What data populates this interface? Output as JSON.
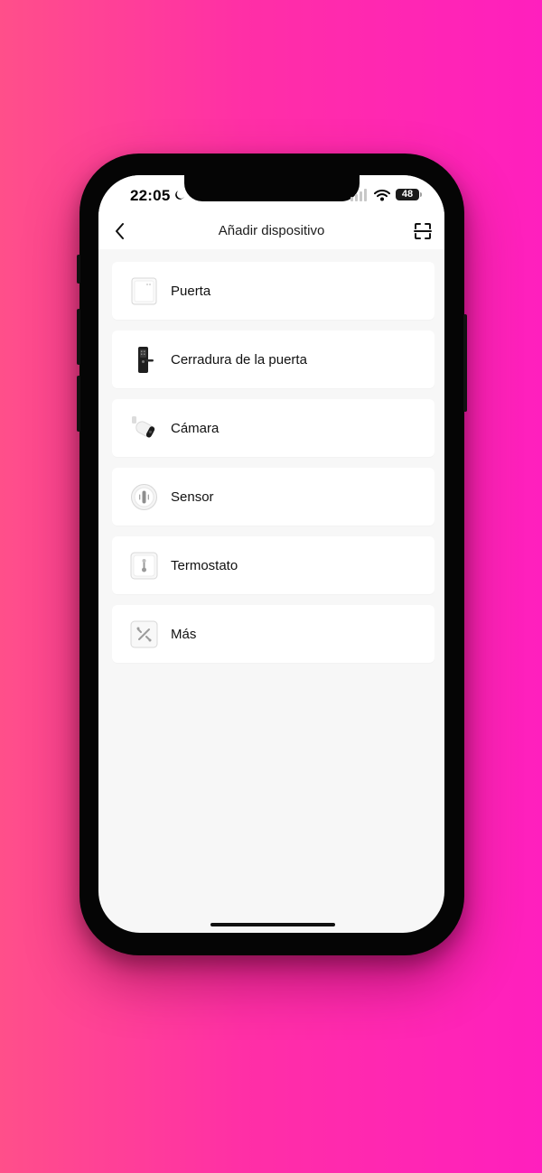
{
  "status_bar": {
    "time": "22:05",
    "battery": "48"
  },
  "nav": {
    "title": "Añadir dispositivo"
  },
  "devices": [
    {
      "label": "Puerta",
      "icon": "gateway-icon"
    },
    {
      "label": "Cerradura de la puerta",
      "icon": "door-lock-icon"
    },
    {
      "label": "Cámara",
      "icon": "camera-icon"
    },
    {
      "label": "Sensor",
      "icon": "sensor-icon"
    },
    {
      "label": "Termostato",
      "icon": "thermostat-icon"
    },
    {
      "label": "Más",
      "icon": "tools-icon"
    }
  ],
  "colors": {
    "background_left": "#ff4f8a",
    "background_right": "#ff1fbe",
    "screen_bg": "#f7f7f7",
    "card_bg": "#ffffff"
  }
}
